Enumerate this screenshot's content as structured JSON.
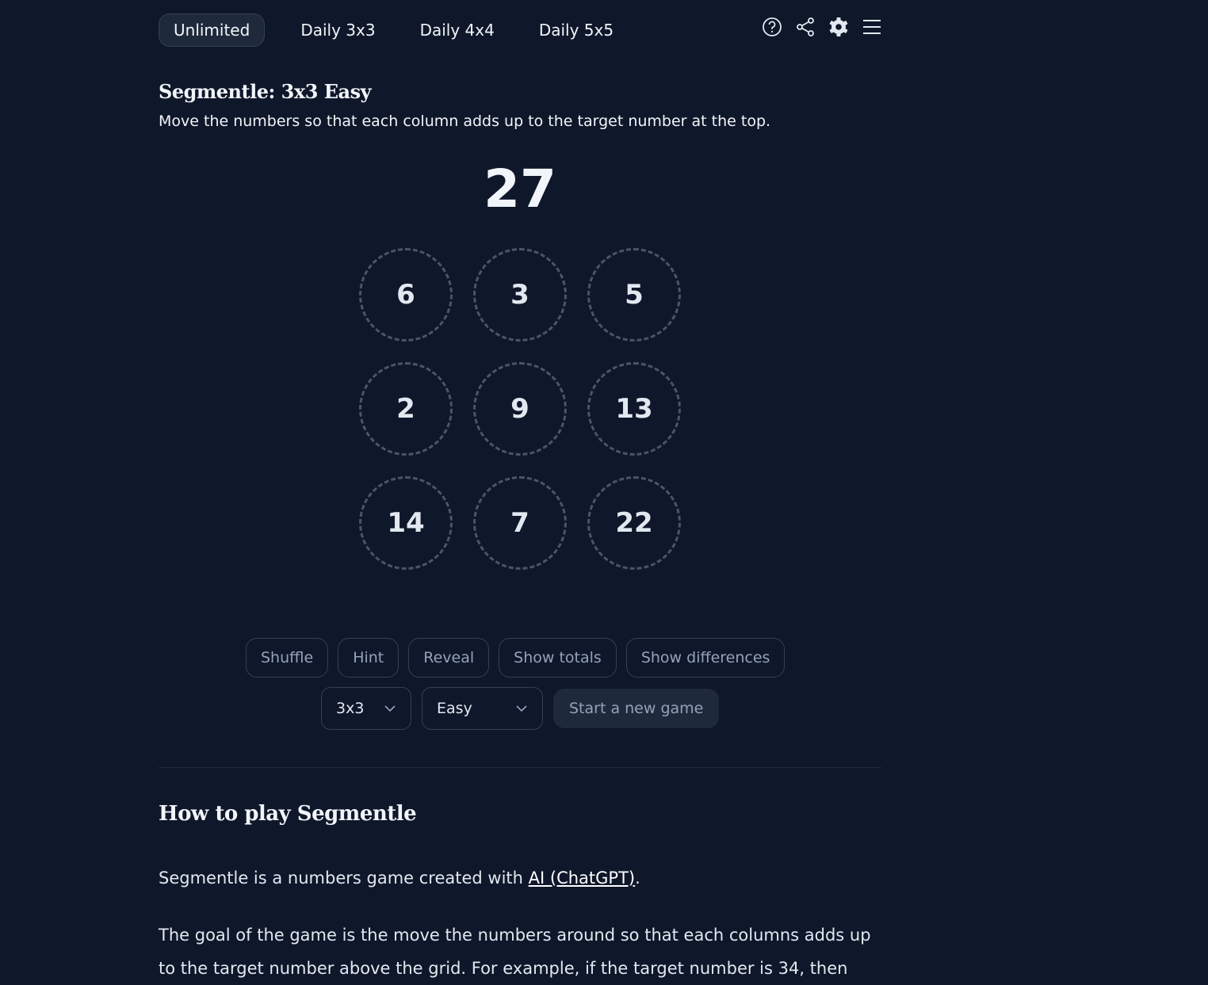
{
  "nav": {
    "tabs": [
      {
        "label": "Unlimited"
      },
      {
        "label": "Daily 3x3"
      },
      {
        "label": "Daily 4x4"
      },
      {
        "label": "Daily 5x5"
      }
    ],
    "icons": [
      "help-icon",
      "share-icon",
      "gear-icon",
      "menu-icon"
    ]
  },
  "game": {
    "title": "Segmentle: 3x3 Easy",
    "instructions": "Move the numbers so that each column adds up to the target number at the top.",
    "target": "27",
    "grid": [
      "6",
      "3",
      "5",
      "2",
      "9",
      "13",
      "14",
      "7",
      "22"
    ]
  },
  "controls": {
    "shuffle": "Shuffle",
    "hint": "Hint",
    "reveal": "Reveal",
    "show_totals": "Show totals",
    "show_differences": "Show differences",
    "size": "3x3",
    "difficulty": "Easy",
    "start": "Start a new game"
  },
  "howto": {
    "title": "How to play Segmentle",
    "p1_before": "Segmentle is a numbers game created with ",
    "p1_link": "AI (ChatGPT)",
    "p1_after": ".",
    "p2": "The goal of the game is the move the numbers around so that each columns adds up to the target number above the grid. For example, if the target number is 34, then"
  }
}
